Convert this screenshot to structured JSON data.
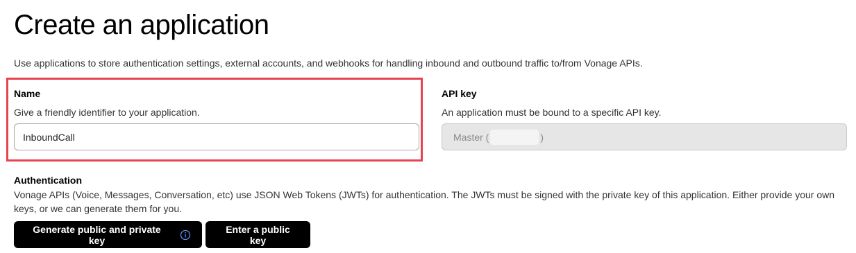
{
  "page": {
    "title": "Create an application",
    "intro": "Use applications to store authentication settings, external accounts, and webhooks for handling inbound and outbound traffic to/from Vonage APIs."
  },
  "name_field": {
    "label": "Name",
    "help": "Give a friendly identifier to your application.",
    "value": "InboundCall"
  },
  "api_key_field": {
    "label": "API key",
    "help": "An application must be bound to a specific API key.",
    "value_prefix": "Master (",
    "value_suffix": ")"
  },
  "authentication": {
    "label": "Authentication",
    "description": "Vonage APIs (Voice, Messages, Conversation, etc) use JSON Web Tokens (JWTs) for authentication. The JWTs must be signed with the private key of this application. Either provide your own keys, or we can generate them for you.",
    "generate_button": "Generate public and private key",
    "enter_key_button": "Enter a public key",
    "info_icon": "info-circle-icon"
  },
  "colors": {
    "highlight": "#e8424f",
    "info_icon": "#5b8def",
    "button_bg": "#000000"
  }
}
